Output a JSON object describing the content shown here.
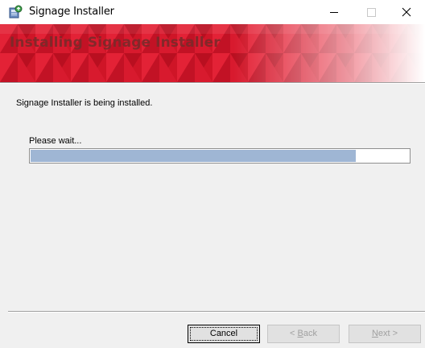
{
  "window": {
    "title": "Signage Installer",
    "controls": [
      "minimize",
      "maximize",
      "close"
    ]
  },
  "banner": {
    "title": "Installing Signage Installer",
    "accent_color": "#d1152a"
  },
  "main": {
    "status_text": "Signage Installer is being installed.",
    "wait_label": "Please wait...",
    "progress_percent": 86
  },
  "footer": {
    "cancel_label": "Cancel",
    "back_prefix": "< ",
    "back_accel": "B",
    "back_rest": "ack",
    "next_accel": "N",
    "next_rest": "ext >"
  },
  "icons": {
    "app": "installer-icon",
    "minimize": "minimize-icon",
    "maximize": "maximize-icon",
    "close": "close-icon"
  }
}
